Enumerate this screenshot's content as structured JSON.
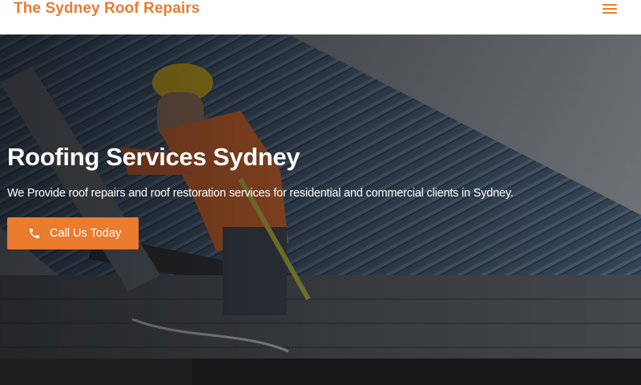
{
  "header": {
    "brand": "The Sydney Roof Repairs",
    "menu_icon": "hamburger-menu-icon"
  },
  "hero": {
    "title": "Roofing Services Sydney",
    "subtitle": "We Provide roof repairs and roof restoration services for residential and commercial clients in Sydney.",
    "cta_label": "Call Us Today",
    "cta_icon": "phone-icon"
  },
  "colors": {
    "accent": "#ea7b2f",
    "hero_overlay": "#2a2e35",
    "text_on_dark": "#ffffff"
  }
}
